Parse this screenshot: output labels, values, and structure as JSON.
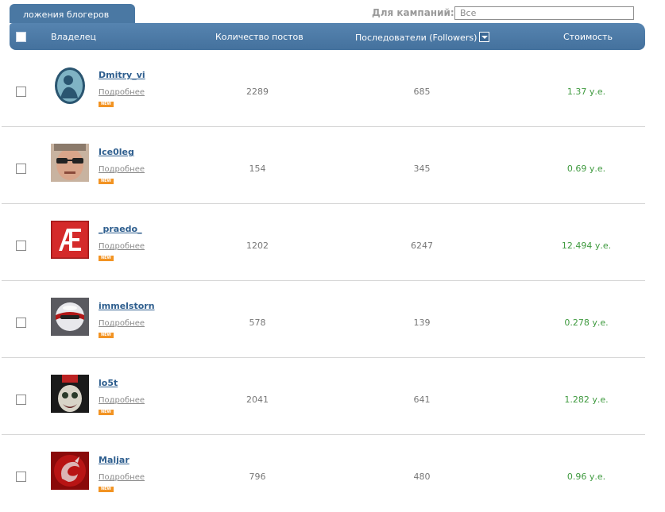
{
  "tab_label": "ложения блогеров",
  "campaign": {
    "label": "Для кампаний:",
    "value": "Все"
  },
  "columns": {
    "owner": "Владелец",
    "posts": "Количество постов",
    "followers": "Последователи (Followers)",
    "price": "Стоимость"
  },
  "rows": [
    {
      "username": "Dmitry_vi",
      "more": "Подробнее",
      "badge": "NEW",
      "posts": "2289",
      "followers": "685",
      "price": "1.37 у.е.",
      "avatar": "silhouette-avatar"
    },
    {
      "username": "Ice0leg",
      "more": "Подробнее",
      "badge": "NEW",
      "posts": "154",
      "followers": "345",
      "price": "0.69 у.е.",
      "avatar": "face-sunglasses-avatar"
    },
    {
      "username": "_praedo_",
      "more": "Подробнее",
      "badge": "NEW",
      "posts": "1202",
      "followers": "6247",
      "price": "12.494 у.е.",
      "avatar": "ae-logo-avatar"
    },
    {
      "username": "immelstorn",
      "more": "Подробнее",
      "badge": "NEW",
      "posts": "578",
      "followers": "139",
      "price": "0.278 у.е.",
      "avatar": "robot-ball-avatar"
    },
    {
      "username": "lo5t",
      "more": "Подробнее",
      "badge": "NEW",
      "posts": "2041",
      "followers": "641",
      "price": "1.282 у.е.",
      "avatar": "clown-face-avatar"
    },
    {
      "username": "Maljar",
      "more": "Подробнее",
      "badge": "NEW",
      "posts": "796",
      "followers": "480",
      "price": "0.96 у.е.",
      "avatar": "red-dragon-avatar"
    }
  ]
}
